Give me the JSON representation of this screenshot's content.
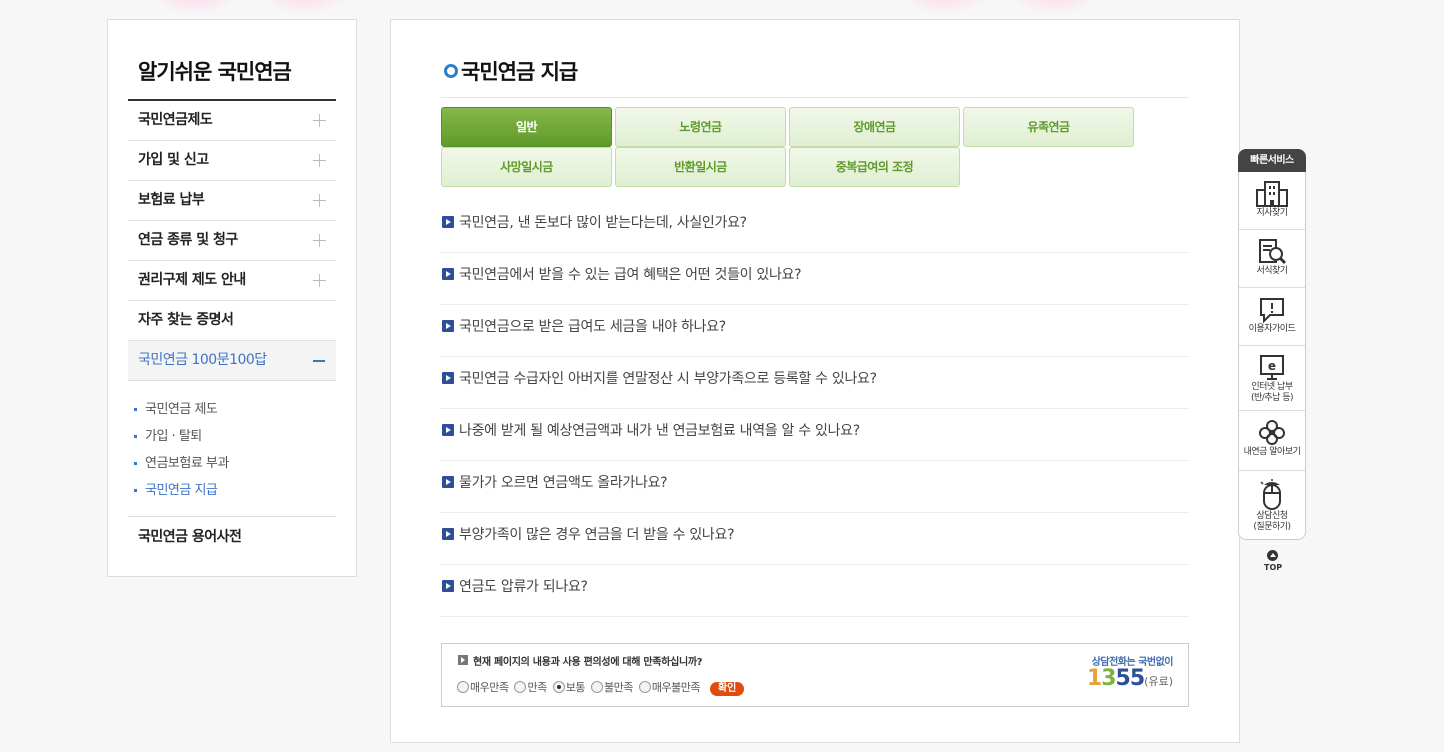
{
  "sidebar": {
    "title": "알기쉬운 국민연금",
    "menu": [
      {
        "label": "국민연금제도"
      },
      {
        "label": "가입 및 신고"
      },
      {
        "label": "보험료 납부"
      },
      {
        "label": "연금 종류 및 청구"
      },
      {
        "label": "권리구제 제도 안내"
      },
      {
        "label": "자주 찾는 증명서"
      },
      {
        "label": "국민연금 100문100답"
      }
    ],
    "submenu": [
      "국민연금 제도",
      "가입 · 탈퇴",
      "연금보험료 부과",
      "국민연금 지급"
    ],
    "last_item": "국민연금 용어사전"
  },
  "main": {
    "title": "국민연금 지급",
    "tabs": [
      "일반",
      "노령연금",
      "장애연금",
      "유족연금",
      "사망일시금",
      "반환일시금",
      "중복급여의 조정"
    ],
    "questions": [
      "국민연금, 낸 돈보다 많이 받는다는데, 사실인가요?",
      "국민연금에서 받을 수 있는 급여 혜택은 어떤 것들이 있나요?",
      "국민연금으로 받은 급여도 세금을 내야 하나요?",
      "국민연금 수급자인 아버지를 연말정산 시 부양가족으로 등록할 수 있나요?",
      "나중에 받게 될 예상연금액과 내가 낸 연금보험료 내역을 알 수 있나요?",
      "물가가 오르면 연금액도 올라가나요?",
      "부양가족이 많은 경우 연금을 더 받을 수 있나요?",
      "연금도 압류가 되나요?"
    ]
  },
  "survey": {
    "question": "현재 페이지의 내용과 사용 편의성에 대해 만족하십니까?",
    "options": [
      "매우만족",
      "만족",
      "보통",
      "불만족",
      "매우불만족"
    ],
    "selected": "보통",
    "submit_label": "확인",
    "call_label": "상담전화는 국번없이",
    "call_digits": [
      "1",
      "3",
      "5",
      "5"
    ],
    "call_suffix": "(유료)"
  },
  "quick_service": {
    "title": "빠른서비스",
    "items": [
      {
        "label": "지사찾기",
        "icon": "building-icon"
      },
      {
        "label": "서식찾기",
        "icon": "document-search-icon"
      },
      {
        "label": "이용자가이드",
        "icon": "speech-bubble-icon"
      },
      {
        "label": "인터넷 납부\n(반/추납 등)",
        "icon": "monitor-e-icon"
      },
      {
        "label": "내연금 알아보기",
        "icon": "clover-icon"
      },
      {
        "label": "상담신청\n(질문하기)",
        "icon": "mouse-icon"
      }
    ],
    "top_label": "TOP"
  },
  "colors": {
    "accent_blue": "#3e73c7",
    "tab_active": "#5f9a2b",
    "submit_button": "#e14b0f",
    "call_digit_colors": [
      "#e8a23a",
      "#7cb341",
      "#2c4f9a",
      "#2c4f9a"
    ]
  }
}
